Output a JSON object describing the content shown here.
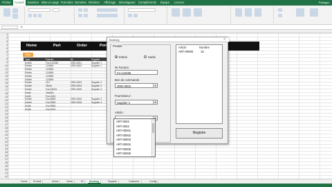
{
  "ribbon_tabs": [
    "Fichier",
    "Accueil",
    "Insertion",
    "Mise en page",
    "Formules",
    "Données",
    "Révision",
    "Affichage",
    "Développeur",
    "Compléments",
    "Équipe",
    "Licence"
  ],
  "ribbon_active": "Accueil",
  "share": "Partager",
  "sheet": {
    "header": [
      "Home",
      "Part",
      "Order",
      "Porte"
    ],
    "sale_button": "Sale",
    "table_headers": [
      "Type",
      "Facture",
      "Nr",
      "Supplier"
    ],
    "rows": [
      [
        "Entrée",
        "Fac-123456",
        "ORD-0001",
        "Supplier 1"
      ],
      [
        "Entrée",
        "123456",
        "ORD-0002",
        "Supplier 1"
      ],
      [
        "Entrée",
        "123456",
        "",
        ""
      ],
      [
        "Entrée",
        "123456",
        "",
        ""
      ],
      [
        "Entrée",
        "123456",
        "",
        ""
      ],
      [
        "Entrée",
        "123456",
        "",
        ""
      ],
      [
        "Entrée",
        "212",
        "ORD-0003",
        "Supplier 2"
      ],
      [
        "Entrée",
        "1Bvaf",
        "ORD-0004",
        "Supplier 2"
      ],
      [
        "Entrée",
        "Fac-18034",
        "ORD-0005",
        "Supplier 3"
      ],
      [
        "Sortie",
        "Test451",
        "",
        ""
      ],
      [
        "Sortie",
        "Fac-4444",
        "",
        ""
      ],
      [
        "Entrée",
        "Fac-5555",
        "ORD-0006",
        "Supplier 4"
      ],
      [
        "Entrée",
        "Fac-5555",
        "ORD-0006",
        "Supplier 4"
      ],
      [
        "Sortie",
        "Fac-5556",
        "",
        ""
      ],
      [
        "Sortie",
        "Fac-0000",
        "",
        ""
      ]
    ]
  },
  "sheet_tabs": [
    "Home",
    "Produit",
    "Achat",
    "Vente",
    "St",
    "Booking",
    "Supplier",
    "Customer",
    "Config"
  ],
  "sheet_tab_active": "Booking",
  "dialog": {
    "title": "Booking",
    "close": "×",
    "frame_label": "Produit",
    "radio_entree": "Entrée",
    "radio_sortie": "Sortie",
    "facture_label": "Nr Facture:",
    "facture_value": "Fa-123456",
    "bon_label": "Bon de commande :",
    "bon_value": "ORD-0003",
    "fournisseur_label": "Fournisseur :",
    "fournisseur_value": "Supplier 4",
    "article_label": "Article :",
    "article_value": "",
    "list_header_article": "Article",
    "list_header_nombre": "Nombre",
    "list_article": "ART-00006",
    "list_nombre": "15",
    "register_button": "Registre",
    "dropdown_options": [
      "ART-0002",
      "ART-0002",
      "ART-00001",
      "ART-00002",
      "ART-00003",
      "ART-00004",
      "ART-00005",
      "ART-00006"
    ]
  }
}
